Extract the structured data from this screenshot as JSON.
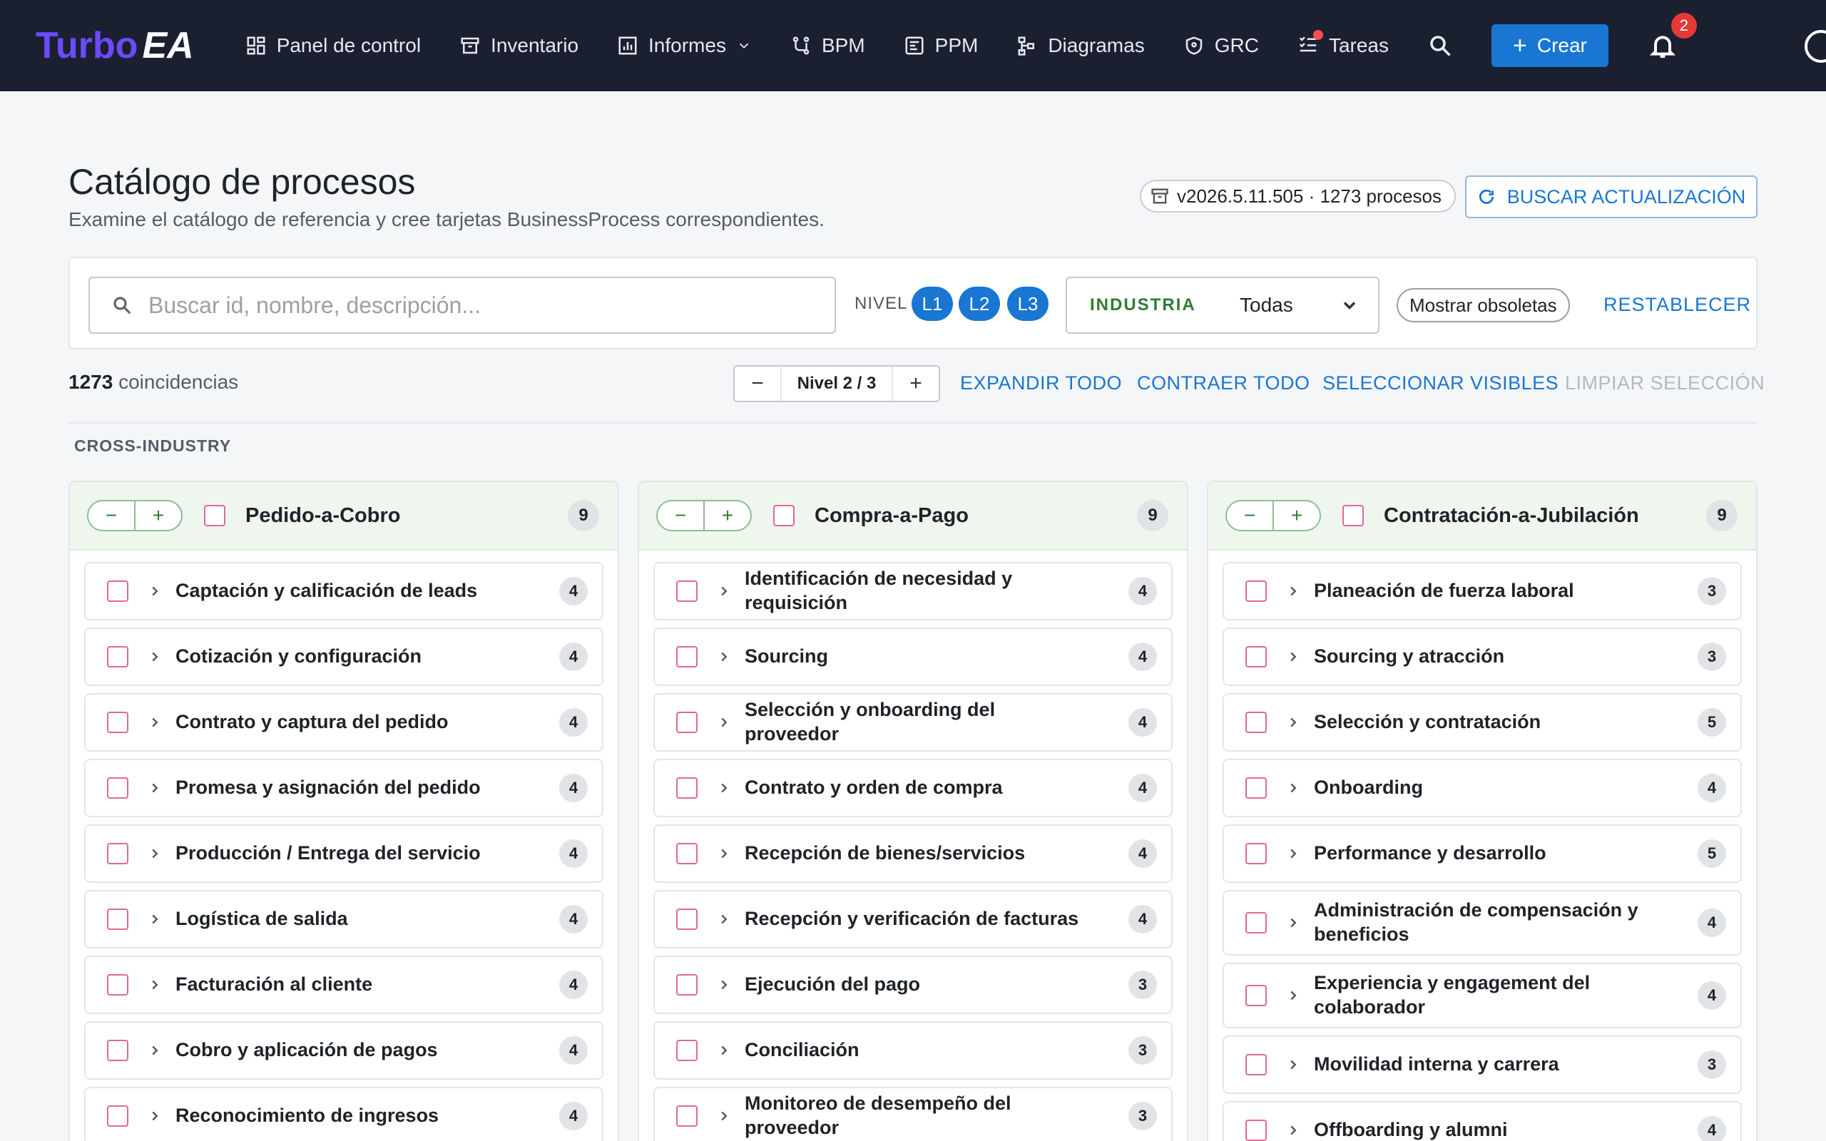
{
  "app": {
    "logo_turbo": "Turbo",
    "logo_ea": "EA"
  },
  "nav": {
    "items": [
      {
        "label": "Panel de control",
        "icon": "dashboard-icon"
      },
      {
        "label": "Inventario",
        "icon": "archive-icon"
      },
      {
        "label": "Informes",
        "icon": "chart-icon"
      },
      {
        "label": "BPM",
        "icon": "flow-icon"
      },
      {
        "label": "PPM",
        "icon": "project-icon"
      },
      {
        "label": "Diagramas",
        "icon": "diagram-icon"
      },
      {
        "label": "GRC",
        "icon": "shield-icon"
      },
      {
        "label": "Tareas",
        "icon": "checklist-icon"
      }
    ],
    "create_label": "Crear",
    "notifications_count": "2"
  },
  "page": {
    "title": "Catálogo de procesos",
    "subtitle": "Examine el catálogo de referencia y cree tarjetas BusinessProcess correspondientes.",
    "version": "v2026.5.11.505 · 1273 procesos",
    "update_label": "BUSCAR ACTUALIZACIÓN"
  },
  "filters": {
    "search_placeholder": "Buscar id, nombre, descripción...",
    "search_value": "",
    "level_label": "NIVEL",
    "levels": [
      "L1",
      "L2",
      "L3"
    ],
    "industry_label": "INDUSTRIA",
    "industry_value": "Todas",
    "show_obsolete_label": "Mostrar obsoletas",
    "reset_label": "RESTABLECER"
  },
  "toolbar": {
    "match_count": "1273",
    "match_label": "coincidencias",
    "level_stepper_value": "Nivel 2 / 3",
    "expand_all": "EXPANDIR TODO",
    "collapse_all": "CONTRAER TODO",
    "select_visible": "SELECCIONAR VISIBLES",
    "clear_selection": "LIMPIAR SELECCIÓN"
  },
  "section": {
    "label": "CROSS-INDUSTRY"
  },
  "columns": [
    {
      "title": "Pedido-a-Cobro",
      "count": "9",
      "items": [
        {
          "label": "Captación y calificación de leads",
          "count": "4"
        },
        {
          "label": "Cotización y configuración",
          "count": "4"
        },
        {
          "label": "Contrato y captura del pedido",
          "count": "4"
        },
        {
          "label": "Promesa y asignación del pedido",
          "count": "4"
        },
        {
          "label": "Producción / Entrega del servicio",
          "count": "4"
        },
        {
          "label": "Logística de salida",
          "count": "4"
        },
        {
          "label": "Facturación al cliente",
          "count": "4"
        },
        {
          "label": "Cobro y aplicación de pagos",
          "count": "4"
        },
        {
          "label": "Reconocimiento de ingresos",
          "count": "4"
        }
      ]
    },
    {
      "title": "Compra-a-Pago",
      "count": "9",
      "items": [
        {
          "label": "Identificación de necesidad y requisición",
          "count": "4"
        },
        {
          "label": "Sourcing",
          "count": "4"
        },
        {
          "label": "Selección y onboarding del proveedor",
          "count": "4"
        },
        {
          "label": "Contrato y orden de compra",
          "count": "4"
        },
        {
          "label": "Recepción de bienes/servicios",
          "count": "4"
        },
        {
          "label": "Recepción y verificación de facturas",
          "count": "4"
        },
        {
          "label": "Ejecución del pago",
          "count": "3"
        },
        {
          "label": "Conciliación",
          "count": "3"
        },
        {
          "label": "Monitoreo de desempeño del proveedor",
          "count": "3"
        }
      ]
    },
    {
      "title": "Contratación-a-Jubilación",
      "count": "9",
      "items": [
        {
          "label": "Planeación de fuerza laboral",
          "count": "3"
        },
        {
          "label": "Sourcing y atracción",
          "count": "3"
        },
        {
          "label": "Selección y contratación",
          "count": "5"
        },
        {
          "label": "Onboarding",
          "count": "4"
        },
        {
          "label": "Performance y desarrollo",
          "count": "5"
        },
        {
          "label": "Administración de compensación y beneficios",
          "count": "4"
        },
        {
          "label": "Experiencia y engagement del colaborador",
          "count": "4"
        },
        {
          "label": "Movilidad interna y carrera",
          "count": "3"
        },
        {
          "label": "Offboarding y alumni",
          "count": "4"
        }
      ]
    }
  ]
}
